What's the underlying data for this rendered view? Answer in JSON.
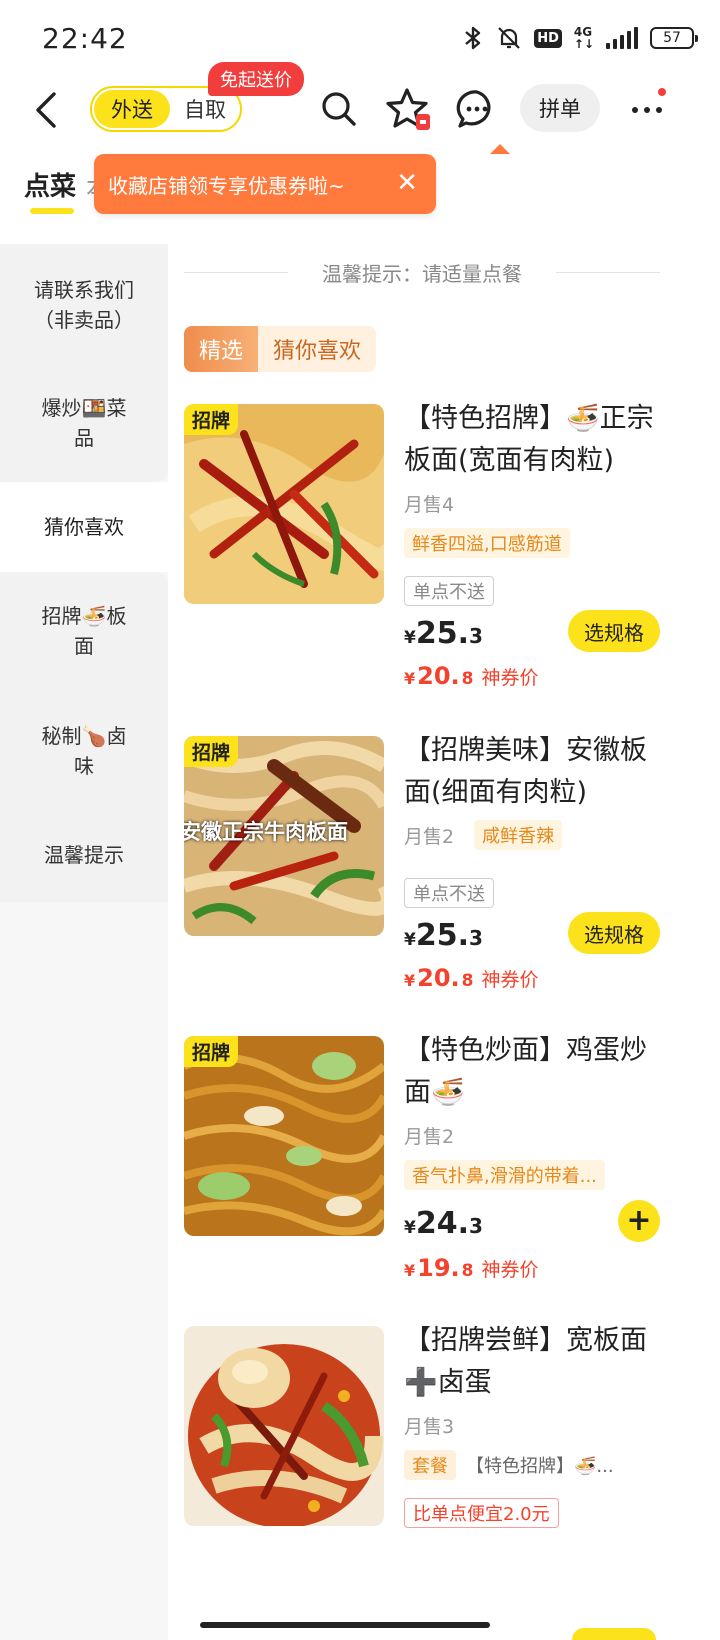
{
  "status_bar": {
    "time": "22:42",
    "network": "4G",
    "battery": "57",
    "icons": [
      "bluetooth-icon",
      "bell-off-icon",
      "hd-icon",
      "signal-icon",
      "battery-icon"
    ]
  },
  "header": {
    "modes": [
      "外送",
      "自取"
    ],
    "active_mode": "外送",
    "promo_badge": "免起送价",
    "group_order_label": "拼单"
  },
  "tabs": {
    "active": "点菜",
    "peek": "本"
  },
  "tooltip": {
    "text": "收藏店铺领专享优惠券啦~",
    "close": "✕"
  },
  "sidebar": {
    "items": [
      {
        "label_l1": "请联系我们",
        "label_l2": "（非卖品）"
      },
      {
        "label_l1": "爆炒🍱菜",
        "label_l2": "品"
      },
      {
        "label_l1": "猜你喜欢",
        "label_l2": ""
      },
      {
        "label_l1": "招牌🍜板",
        "label_l2": "面"
      },
      {
        "label_l1": "秘制🍗卤",
        "label_l2": "味"
      },
      {
        "label_l1": "温馨提示",
        "label_l2": ""
      }
    ],
    "active_index": 2
  },
  "main": {
    "notice": "温馨提示：请适量点餐",
    "section_chip": {
      "selected": "精选",
      "label": "猜你喜欢"
    },
    "items": [
      {
        "badge": "招牌",
        "name": "【特色招牌】🍜正宗板面(宽面有肉粒)",
        "sales": "月售4",
        "taste": "鲜香四溢,口感筋道",
        "no_single": "单点不送",
        "price_yen": "¥",
        "price_int": "25.",
        "price_dec": "3",
        "coupon_yen": "¥",
        "coupon_int": "20.",
        "coupon_dec": "8",
        "coupon_label": "神券价",
        "action": "选规格"
      },
      {
        "badge": "招牌",
        "caption": "安徽正宗牛肉板面",
        "name": "【招牌美味】安徽板面(细面有肉粒)",
        "sales": "月售2",
        "taste": "咸鲜香辣",
        "no_single": "单点不送",
        "price_yen": "¥",
        "price_int": "25.",
        "price_dec": "3",
        "coupon_yen": "¥",
        "coupon_int": "20.",
        "coupon_dec": "8",
        "coupon_label": "神券价",
        "action": "选规格"
      },
      {
        "badge": "招牌",
        "name": "【特色炒面】鸡蛋炒面🍜",
        "sales": "月售2",
        "taste": "香气扑鼻,滑滑的带着...",
        "price_yen": "¥",
        "price_int": "24.",
        "price_dec": "3",
        "coupon_yen": "¥",
        "coupon_int": "19.",
        "coupon_dec": "8",
        "coupon_label": "神券价",
        "action": "+"
      },
      {
        "name": "【招牌尝鲜】宽板面➕卤蛋",
        "sales": "月售3",
        "combo_tag": "套餐",
        "combo_text": "【特色招牌】🍜...",
        "cheaper": "比单点便宜2.0元"
      }
    ]
  },
  "colors": {
    "brand_yellow": "#fce21a",
    "price_red": "#f5422c",
    "tooltip_orange": "#ff7a3c",
    "badge_red": "#f23d3d"
  }
}
